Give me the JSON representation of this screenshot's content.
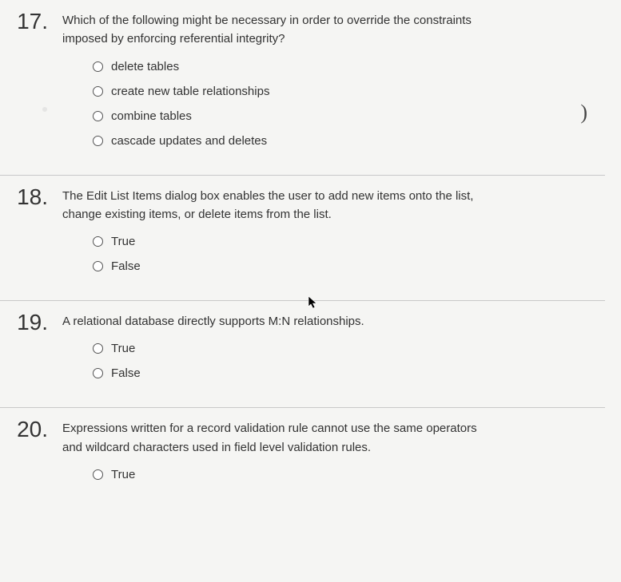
{
  "questions": [
    {
      "number": "17.",
      "text": "Which of the following might be necessary in order to override the constraints imposed by enforcing referential integrity?",
      "options": [
        "delete tables",
        "create new table relationships",
        "combine tables",
        "cascade updates and deletes"
      ]
    },
    {
      "number": "18.",
      "text": "The Edit List Items dialog box enables the user to add new items onto the list, change existing items, or delete items from the list.",
      "options": [
        "True",
        "False"
      ]
    },
    {
      "number": "19.",
      "text": "A relational database directly supports M:N relationships.",
      "options": [
        "True",
        "False"
      ]
    },
    {
      "number": "20.",
      "text": "Expressions written for a record validation rule cannot use the same operators and wildcard characters used in field level validation rules.",
      "options": [
        "True"
      ]
    }
  ],
  "stray_mark": ")"
}
